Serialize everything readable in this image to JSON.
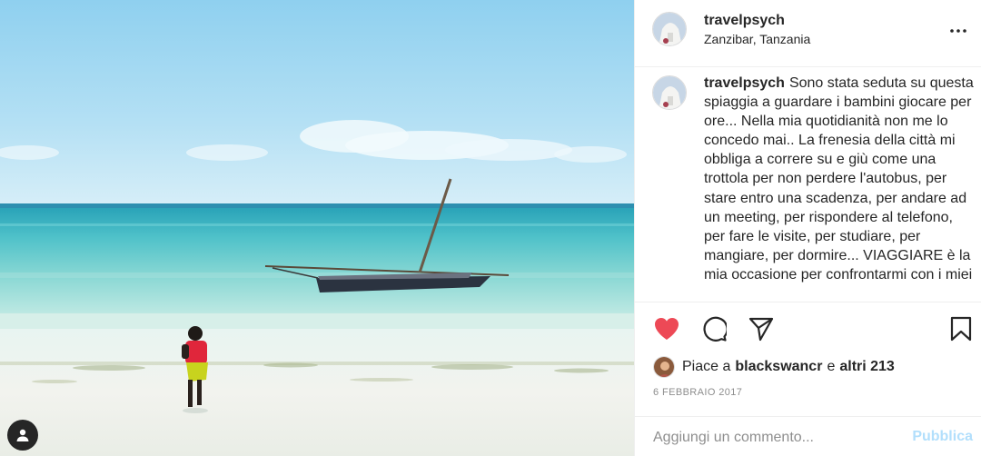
{
  "post": {
    "username": "travelpsych",
    "location": "Zanzibar, Tanzania",
    "caption": "Sono stata seduta su questa spiaggia a guardare i bambini giocare per ore... Nella mia quotidianità non me lo concedo mai.. La frenesia della città mi obbliga a correre su e giù come una trottola per non perdere l'autobus, per stare entro una scadenza, per andare ad un meeting, per rispondere al telefono, per fare le visite, per studiare, per mangiare, per dormire... VIAGGIARE è la mia occasione per confrontarmi con i miei",
    "liked": true
  },
  "likes": {
    "prefix": "Piace a",
    "user": "blackswancr",
    "conjunction": "e",
    "others": "altri 213"
  },
  "date": "6 FEBBRAIO 2017",
  "comment": {
    "placeholder": "Aggiungi un commento...",
    "publish_label": "Pubblica"
  },
  "icons": {
    "like": "heart-filled-icon",
    "comment": "comment-icon",
    "share": "paper-plane-icon",
    "save": "bookmark-icon",
    "more": "more-dots-icon",
    "user_tag": "user-tag-icon"
  },
  "colors": {
    "like_red": "#ed4956",
    "text": "#262626",
    "muted": "#8e8e8e",
    "publish_disabled": "#b2dffc",
    "border": "#efefef"
  }
}
